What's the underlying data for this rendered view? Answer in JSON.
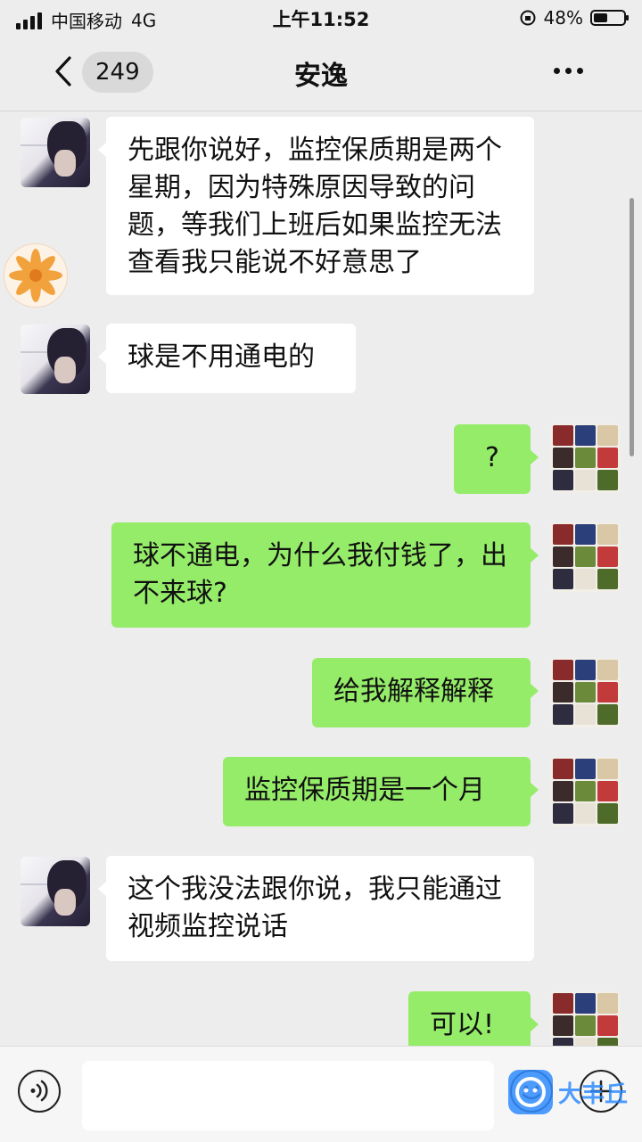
{
  "status_bar": {
    "carrier": "中国移动",
    "network": "4G",
    "time": "上午11:52",
    "battery": "48%",
    "battery_level": 0.48
  },
  "header": {
    "unread_count": "249",
    "title": "安逸",
    "back_icon": "chevron-left-icon",
    "more_icon": "more-dots-icon"
  },
  "messages": [
    {
      "side": "in",
      "text": "先跟你说好，监控保质期是两个星期，因为特殊原因导致的问题，等我们上班后如果监控无法查看我只能说不好意思了"
    },
    {
      "side": "in",
      "text": "球是不用通电的"
    },
    {
      "side": "out",
      "text": "?"
    },
    {
      "side": "out",
      "text": "球不通电，为什么我付钱了，出不来球?"
    },
    {
      "side": "out",
      "text": "给我解释解释"
    },
    {
      "side": "out",
      "text": "监控保质期是一个月"
    },
    {
      "side": "in",
      "text": "这个我没法跟你说，我只能通过视频监控说话"
    },
    {
      "side": "out",
      "text": "可以!"
    }
  ],
  "input_bar": {
    "voice_icon": "voice-icon",
    "text_value": "",
    "emoji_icon": "emoji-icon",
    "plus_icon": "plus-icon"
  },
  "watermark": {
    "text": "大丰丘"
  },
  "colors": {
    "outgoing": "#95ec69",
    "incoming": "#ffffff",
    "background": "#ededed"
  }
}
